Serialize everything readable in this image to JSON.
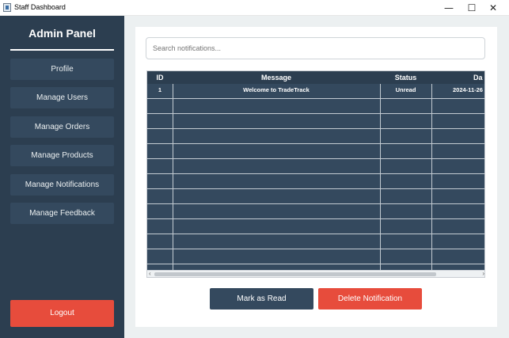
{
  "window": {
    "title": "Staff Dashboard",
    "minimize": "—",
    "maximize": "☐",
    "close": "✕"
  },
  "sidebar": {
    "brand": "Admin Panel",
    "items": [
      {
        "label": "Profile"
      },
      {
        "label": "Manage Users"
      },
      {
        "label": "Manage Orders"
      },
      {
        "label": "Manage Products"
      },
      {
        "label": "Manage Notifications"
      },
      {
        "label": "Manage Feedback"
      }
    ],
    "logout": "Logout"
  },
  "main": {
    "search": {
      "placeholder": "Search notifications...",
      "value": ""
    },
    "table": {
      "columns": [
        "ID",
        "Message",
        "Status",
        "Da"
      ],
      "rows": [
        [
          "1",
          "Welcome to TradeTrack",
          "Unread",
          "2024-11-26"
        ]
      ]
    },
    "buttons": {
      "mark_read": "Mark as Read",
      "delete": "Delete Notification"
    }
  },
  "colors": {
    "sidebar_bg": "#2c3e50",
    "nav_button": "#34495e",
    "danger": "#e74c3c",
    "content_bg": "#ecf0f1"
  }
}
